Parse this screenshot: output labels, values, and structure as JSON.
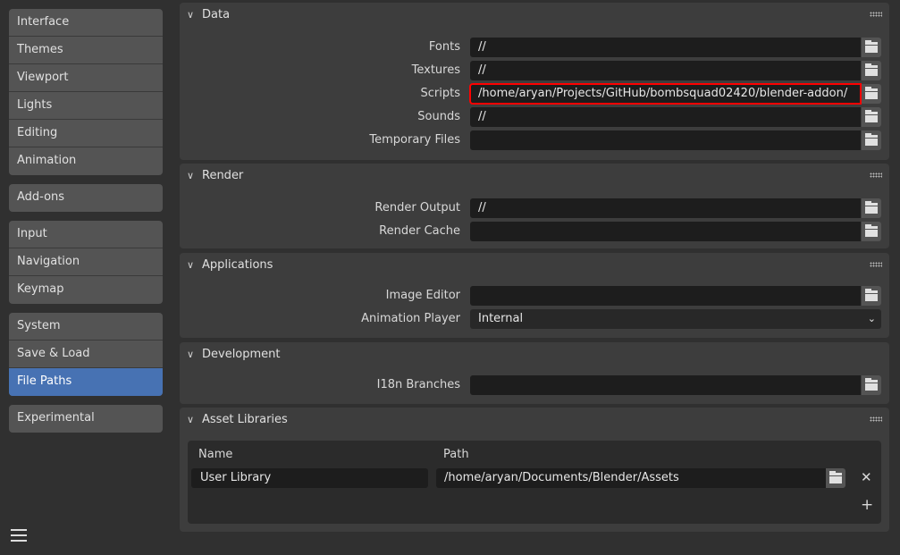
{
  "sidebar": {
    "groups": [
      [
        "Interface",
        "Themes",
        "Viewport",
        "Lights",
        "Editing",
        "Animation"
      ],
      [
        "Add-ons"
      ],
      [
        "Input",
        "Navigation",
        "Keymap"
      ],
      [
        "System",
        "Save & Load",
        "File Paths"
      ],
      [
        "Experimental"
      ]
    ],
    "active": "File Paths"
  },
  "data": {
    "title": "Data",
    "rows": [
      {
        "label": "Fonts",
        "value": "//"
      },
      {
        "label": "Textures",
        "value": "//"
      },
      {
        "label": "Scripts",
        "value": "/home/aryan/Projects/GitHub/bombsquad02420/blender-addon/",
        "highlighted": true
      },
      {
        "label": "Sounds",
        "value": "//"
      },
      {
        "label": "Temporary Files",
        "value": ""
      }
    ]
  },
  "render": {
    "title": "Render",
    "rows": [
      {
        "label": "Render Output",
        "value": "//"
      },
      {
        "label": "Render Cache",
        "value": ""
      }
    ]
  },
  "applications": {
    "title": "Applications",
    "image_editor_label": "Image Editor",
    "image_editor_value": "",
    "animation_player_label": "Animation Player",
    "animation_player_value": "Internal"
  },
  "development": {
    "title": "Development",
    "i18n_label": "I18n Branches",
    "i18n_value": ""
  },
  "asset_libraries": {
    "title": "Asset Libraries",
    "name_header": "Name",
    "path_header": "Path",
    "libraries": [
      {
        "name": "User Library",
        "path": "/home/aryan/Documents/Blender/Assets"
      }
    ]
  },
  "colors": {
    "accent": "#4772b3",
    "highlight": "#ff0000"
  }
}
